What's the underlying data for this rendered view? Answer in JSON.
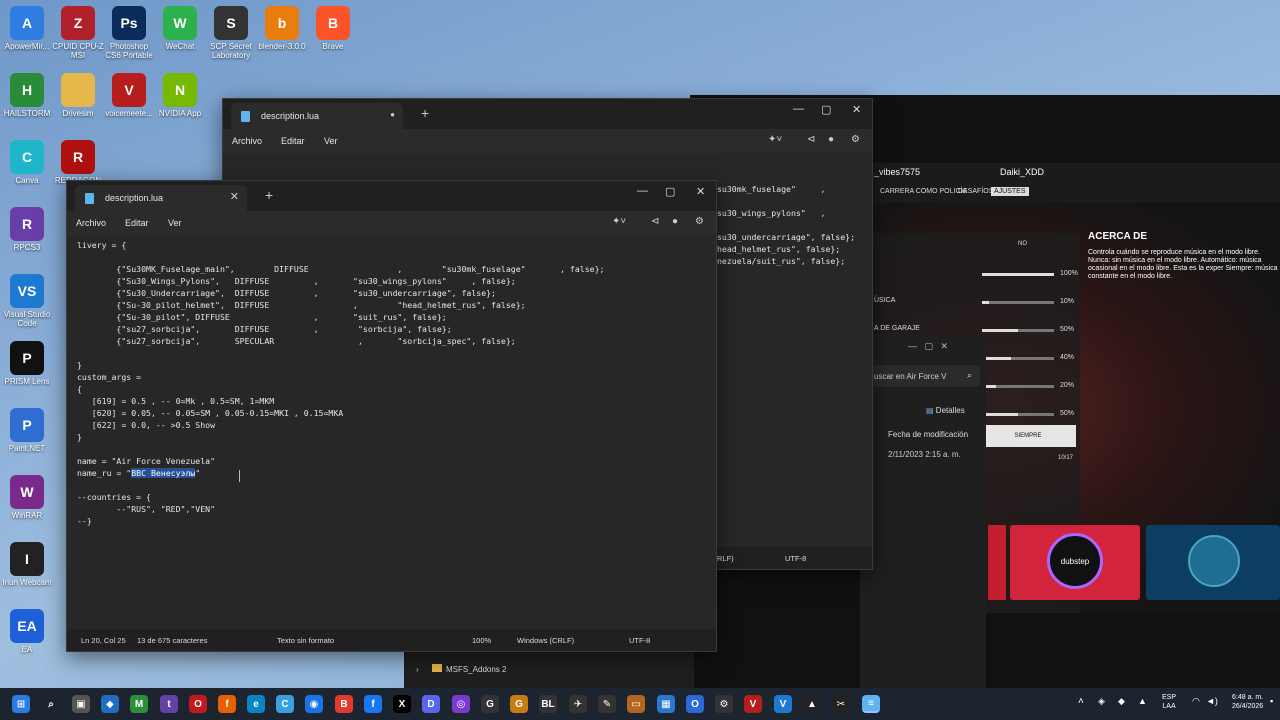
{
  "desktop": {
    "icons": [
      {
        "label": "ApowerMir...",
        "color": "#2f7de1",
        "glyph": "A"
      },
      {
        "label": "CPUID CPU-Z MSI",
        "color": "#b0202a",
        "glyph": "Z"
      },
      {
        "label": "Photoshop CS6 Portable",
        "color": "#0b2c5a",
        "glyph": "Ps"
      },
      {
        "label": "WeChat",
        "color": "#2bb24c",
        "glyph": "W"
      },
      {
        "label": "SCP Secret Laboratory",
        "color": "#333333",
        "glyph": "S"
      },
      {
        "label": "blender-3.0.0",
        "color": "#e87d0d",
        "glyph": "b"
      },
      {
        "label": "Brave",
        "color": "#fb542b",
        "glyph": "B"
      },
      {
        "label": "HAILSTORM",
        "color": "#2a8b3a",
        "glyph": "H"
      },
      {
        "label": "Drivesim",
        "color": "#e6b84a",
        "glyph": ""
      },
      {
        "label": "voicemeete...",
        "color": "#b81d1d",
        "glyph": "V"
      },
      {
        "label": "NVIDIA App",
        "color": "#76b900",
        "glyph": "N"
      },
      {
        "label": "Canva",
        "color": "#1fb6c9",
        "glyph": "C"
      },
      {
        "label": "REDRAGON",
        "color": "#b01010",
        "glyph": "R"
      },
      {
        "label": "RPCS3",
        "color": "#6a3ea8",
        "glyph": "R"
      },
      {
        "label": "Visual Studio Code",
        "color": "#1e7ad1",
        "glyph": "VS"
      },
      {
        "label": "PRISM Lens",
        "color": "#111111",
        "glyph": "P"
      },
      {
        "label": "Paint.NET",
        "color": "#2f6ed0",
        "glyph": "P"
      },
      {
        "label": "WinRAR",
        "color": "#7a2a8a",
        "glyph": "W"
      },
      {
        "label": "Iriun Webcam",
        "color": "#222222",
        "glyph": "I"
      },
      {
        "label": "EA",
        "color": "#1f5fd8",
        "glyph": "EA"
      }
    ]
  },
  "game": {
    "users": [
      "_vibes7575",
      "Daiki_XDD"
    ],
    "nav": [
      "CARRERA COMO POLICÍA",
      "DESAFÍOS",
      "AJUSTES"
    ],
    "info_title": "ACERCA DE",
    "info_text": "Controla cuándo se reproduce música en el modo libre. Nunca: sin música en el modo libre. Automático: música ocasional en el modo libre. Esta es la exper Siempre: música constante en el modo libre.",
    "labels": [
      "NO",
      "ÚSICA",
      "A DE GARAJE",
      "SIEMPRE",
      "10/17"
    ],
    "sliders": [
      {
        "pct": "100%",
        "value": 1.0
      },
      {
        "pct": "10%",
        "value": 0.1
      },
      {
        "pct": "50%",
        "value": 0.5
      },
      {
        "pct": "40%",
        "value": 0.4
      },
      {
        "pct": "20%",
        "value": 0.2
      },
      {
        "pct": "50%",
        "value": 0.5
      }
    ],
    "card_text": "dubstep"
  },
  "explorer": {
    "search": "uscar en Air Force V",
    "details": "Detalles",
    "col_modified": "Fecha de modificación",
    "row_modified": "2/11/2023 2:15 a. m.",
    "folder": "MSFS_Addons 2"
  },
  "notepad_back": {
    "tab": "description.lua",
    "menu": [
      "Archivo",
      "Editar",
      "Ver"
    ],
    "line1": "livery = {",
    "right_lines": [
      "su30mk_fuselage\"     ,",
      "",
      "su30_wings_pylons\"   ,",
      "",
      "su30_undercarriage\", false};",
      "head_helmet_rus\", false};",
      "nezuela/suit_rus\", false};"
    ],
    "status": [
      "RLF)",
      "UTF-8"
    ]
  },
  "notepad_front": {
    "tab": "description.lua",
    "menu": [
      "Archivo",
      "Editar",
      "Ver"
    ],
    "code_before": "livery = {\n\n        {\"Su30MK_Fuselage_main\",        DIFFUSE                  ,        \"su30mk_fuselage\"       , false};\n        {\"Su30_Wings_Pylons\",   DIFFUSE         ,       \"su30_wings_pylons\"     , false};\n        {\"Su30_Undercarriage\",  DIFFUSE         ,       \"su30_undercarriage\", false};\n        {\"Su-30_pilot_helmet\",  DIFFUSE                 ,        \"head_helmet_rus\", false};\n        {\"Su-30_pilot\", DIFFUSE                 ,       \"suit_rus\", false};\n        {\"su27_sorbcija\",       DIFFUSE         ,        \"sorbcija\", false};\n        {\"su27_sorbcija\",       SPECULAR                 ,       \"sorbcija_spec\", false};\n\n}\ncustom_args =\n{\n   [619] = 0.5 , -- 0=Mk , 0.5=SM, 1=MKM\n   [620] = 0.05, -- 0.05=SM , 0.05-0.15=MKI , 0.15=MKA\n   [622] = 0.0, -- >0.5 Show\n}\n\nname = \"Air Force Venezuela\"\nname_ru = \"",
    "code_selected": "ВВС Венесуэлы",
    "code_after": "\"\n\n--countries = {\n        --\"RUS\", \"RED\",\"VEN\"\n--}",
    "status": {
      "position": "Ln 20, Col 25",
      "chars": "13 de 675 caracteres",
      "format": "Texto sin formato",
      "zoom": "100%",
      "eol": "Windows (CRLF)",
      "encoding": "UTF-8"
    }
  },
  "taskbar": {
    "lang": "ESP",
    "lang2": "LAA",
    "time": "6:48 a. m.",
    "date": "26/4/2026"
  }
}
